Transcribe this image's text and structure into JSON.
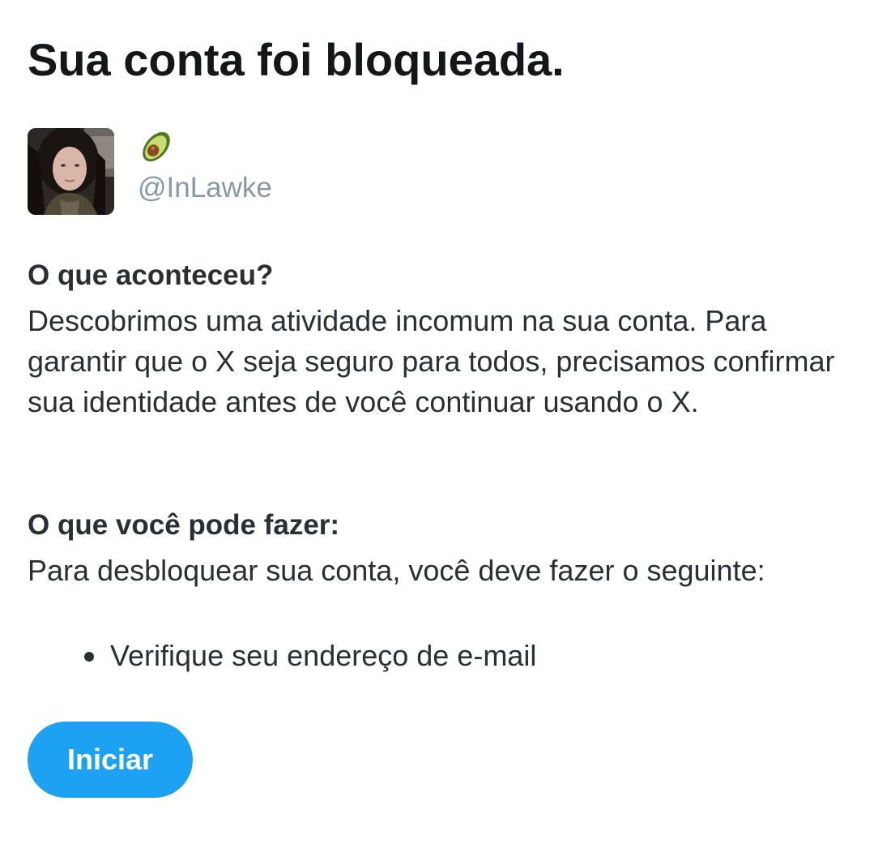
{
  "title": "Sua conta foi bloqueada.",
  "account": {
    "display_name_icon": "avocado-emoji",
    "handle": "@InLawke"
  },
  "what_happened": {
    "heading": "O que aconteceu?",
    "text": "Descobrimos uma atividade incomum na sua conta. Para garantir que o X seja seguro para todos, precisamos confirmar sua identidade antes de você continuar usando o X."
  },
  "what_you_can_do": {
    "heading": "O que você pode fazer:",
    "text": "Para desbloquear sua conta, você deve fazer o seguinte:",
    "steps": [
      "Verifique seu endereço de e-mail"
    ]
  },
  "start_button": {
    "label": "Iniciar"
  },
  "colors": {
    "accent": "#1da1f2",
    "handle": "#8899a6",
    "text": "#292f33"
  }
}
